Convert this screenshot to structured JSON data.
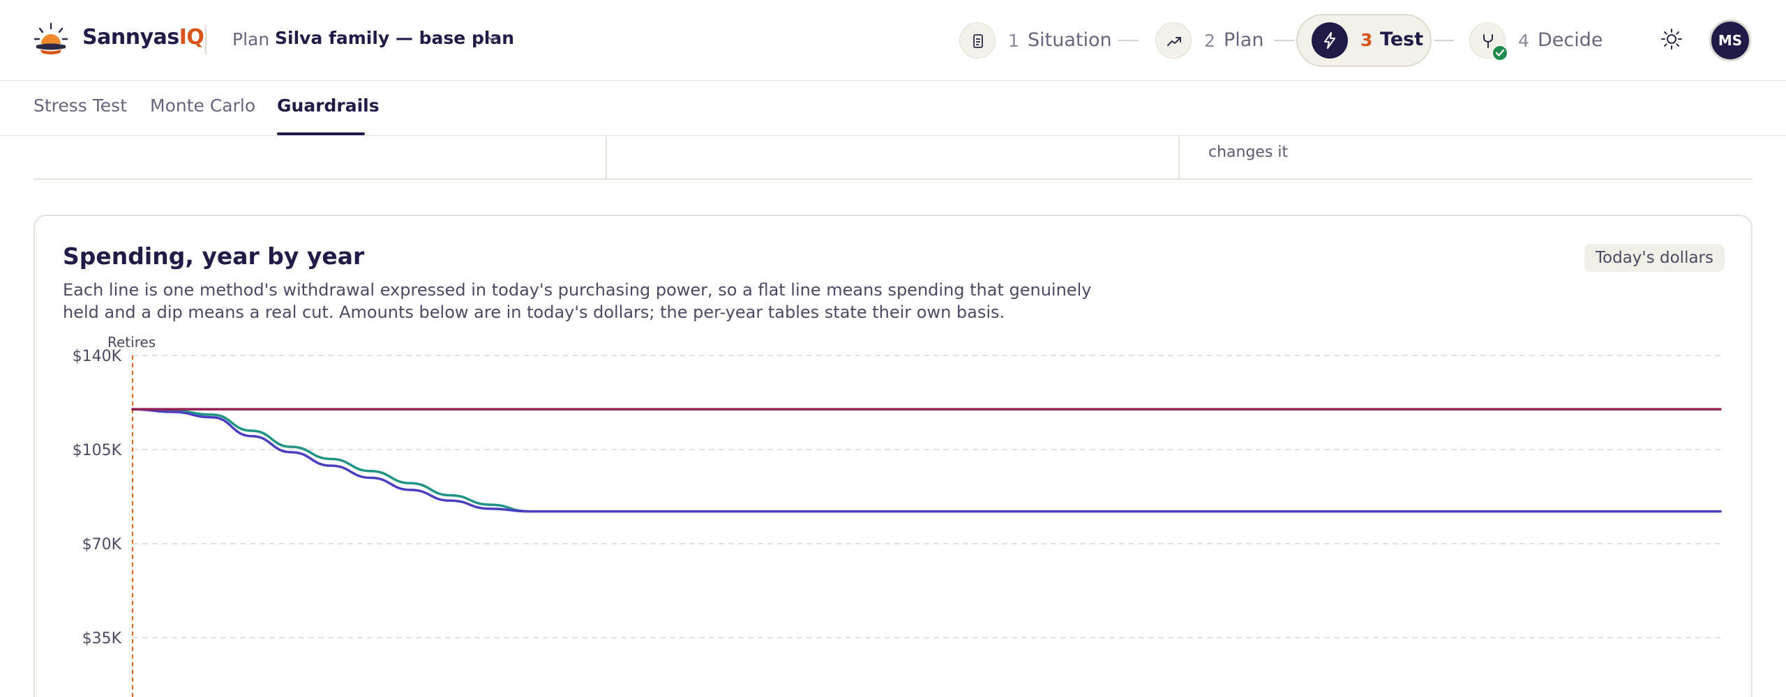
{
  "app": {
    "brand_name": "Sannyas",
    "brand_suffix": "IQ",
    "plan_prefix": "Plan",
    "plan_name": "Silva family — base plan"
  },
  "steps": [
    {
      "number": "1",
      "label": "Situation",
      "icon": "clipboard-icon",
      "state": "visited"
    },
    {
      "number": "2",
      "label": "Plan",
      "icon": "trend-up-icon",
      "state": "visited"
    },
    {
      "number": "3",
      "label": "Test",
      "icon": "lightning-icon",
      "state": "active"
    },
    {
      "number": "4",
      "label": "Decide",
      "icon": "fork-icon",
      "state": "complete"
    }
  ],
  "user": {
    "initials": "MS"
  },
  "tabs": [
    {
      "label": "Stress Test",
      "active": false
    },
    {
      "label": "Monte Carlo",
      "active": false
    },
    {
      "label": "Guardrails",
      "active": true
    }
  ],
  "cards_above": {
    "snippet_3": "changes it"
  },
  "spending_card": {
    "title": "Spending, year by year",
    "badge": "Today's dollars",
    "description": "Each line is one method's withdrawal expressed in today's purchasing power, so a flat line means spending that genuinely held and a dip means a real cut. Amounts below are in today's dollars; the per-year tables state their own basis."
  },
  "colors": {
    "accent": "#d9541a",
    "navy": "#1f1d47",
    "series_teal": "#1f9384",
    "series_indigo": "#4a3fc0",
    "series_crimson": "#951f55",
    "complete_green": "#1e8a4a"
  },
  "chart_data": {
    "type": "line",
    "ylim": [
      0,
      140000
    ],
    "y_ticks": [
      "$140K",
      "$105K",
      "$70K",
      "$35K"
    ],
    "y_tick_values": [
      140000,
      105000,
      70000,
      35000
    ],
    "grid": true,
    "annotations": [
      {
        "label": "Retires",
        "x": 0,
        "style": "dashed-vertical"
      }
    ],
    "x": [
      0,
      2,
      4,
      6,
      8,
      10,
      12,
      14,
      16,
      18,
      20,
      22,
      24,
      26,
      28,
      30,
      32,
      34,
      36,
      38,
      40,
      42,
      44,
      46,
      48,
      50,
      52,
      54,
      56,
      58,
      60,
      62,
      64,
      66,
      68,
      70,
      72,
      74,
      76,
      78,
      80
    ],
    "series": [
      {
        "color": "#1f9384",
        "values": [
          120000,
          119500,
          118000,
          112000,
          106000,
          101500,
          97000,
          92500,
          88000,
          84500,
          82000,
          82000,
          82000,
          82000,
          82000,
          82000,
          82000,
          82000,
          82000,
          82000,
          82000,
          82000,
          82000,
          82000,
          82000,
          82000,
          82000,
          82000,
          82000,
          82000,
          82000,
          82000,
          82000,
          82000,
          82000,
          82000,
          82000,
          82000,
          82000,
          82000,
          82000
        ]
      },
      {
        "color": "#4a3fc0",
        "values": [
          120000,
          119000,
          117000,
          110000,
          104000,
          99000,
          94500,
          90000,
          86000,
          83000,
          82000,
          82000,
          82000,
          82000,
          82000,
          82000,
          82000,
          82000,
          82000,
          82000,
          82000,
          82000,
          82000,
          82000,
          82000,
          82000,
          82000,
          82000,
          82000,
          82000,
          82000,
          82000,
          82000,
          82000,
          82000,
          82000,
          82000,
          82000,
          82000,
          82000,
          82000
        ]
      },
      {
        "color": "#951f55",
        "values": [
          120000,
          120000,
          120000,
          120000,
          120000,
          120000,
          120000,
          120000,
          120000,
          120000,
          120000,
          120000,
          120000,
          120000,
          120000,
          120000,
          120000,
          120000,
          120000,
          120000,
          120000,
          120000,
          120000,
          120000,
          120000,
          120000,
          120000,
          120000,
          120000,
          120000,
          120000,
          120000,
          120000,
          120000,
          120000,
          120000,
          120000,
          120000,
          120000,
          120000,
          120000
        ]
      }
    ]
  }
}
